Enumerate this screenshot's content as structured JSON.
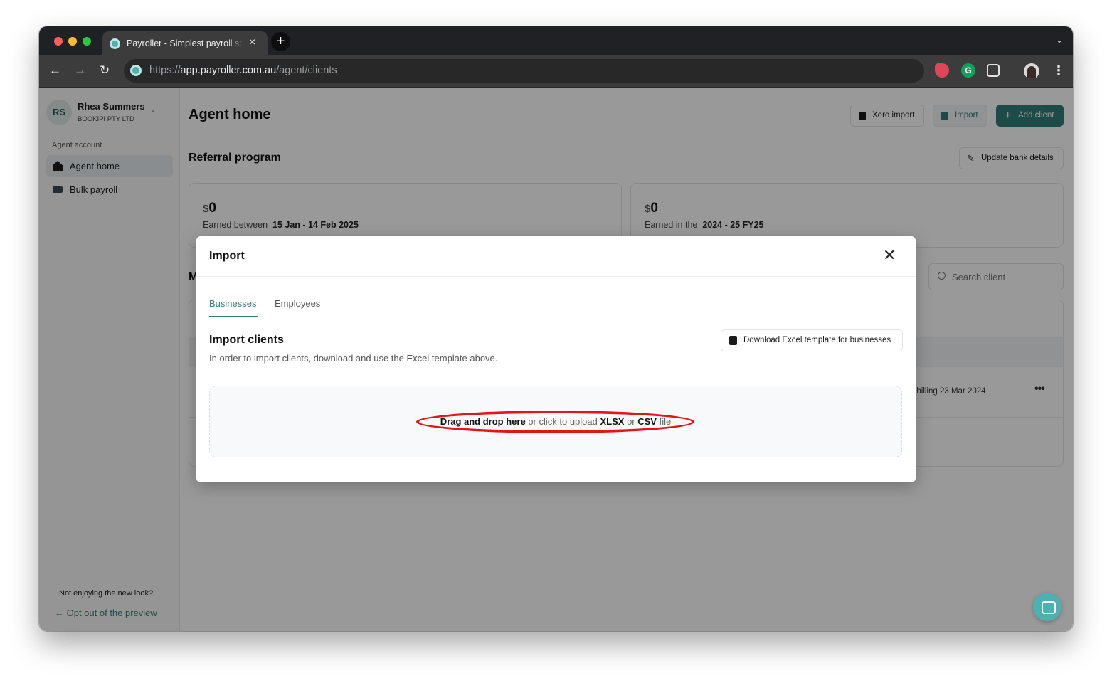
{
  "browser": {
    "tab_title": "Payroller - Simplest payroll software",
    "tab_close": "×",
    "new_tab": "+",
    "url_scheme": "https://",
    "url_host": "app.payroller.com.au",
    "url_path": "/agent/clients"
  },
  "sidebar": {
    "avatar_initials": "RS",
    "user_name": "Rhea Summers",
    "company": "BOOKIPI PTY LTD",
    "section_heading": "Agent account",
    "items": [
      {
        "label": "Agent home",
        "icon": "house-icon",
        "active": true
      },
      {
        "label": "Bulk payroll",
        "icon": "cash-icon",
        "active": false
      }
    ],
    "feedback_question": "Not enjoying the new look?",
    "opt_out_label": "← Opt out of the preview"
  },
  "main": {
    "title": "Agent home",
    "xero_import_label": "Xero import",
    "import_label": "Import",
    "add_client_label": "Add client",
    "referral_title": "Referral program",
    "update_bank_label": "Update bank details",
    "cards": [
      {
        "currency": "$",
        "amount": "0",
        "earned_prefix": "Earned between",
        "period": "15 Jan - 14 Feb  2025"
      },
      {
        "currency": "$",
        "amount": "0",
        "earned_prefix": "Earned in the",
        "period": "2024 - 25  FY25"
      }
    ],
    "clients_heading_partial": "M",
    "search_placeholder": "Search client",
    "row_billing_text": ": billing 23 Mar 2024",
    "row_more": "•••"
  },
  "modal": {
    "title": "Import",
    "close": "✕",
    "tabs": [
      "Businesses",
      "Employees"
    ],
    "active_tab": "Businesses",
    "section_title": "Import clients",
    "section_desc": "In order to import clients, download and use the Excel template above.",
    "template_button": "Download Excel template for businesses",
    "dropzone": {
      "drag_text": "Drag and drop here",
      "middle_text": " or click to upload ",
      "xlsx": "XLSX",
      "or": " or ",
      "csv": "CSV",
      "file": " file"
    },
    "annotation_color": "#e3141b"
  },
  "colors": {
    "brand": "#2f7d78",
    "favicon": "#4fb0b0"
  }
}
